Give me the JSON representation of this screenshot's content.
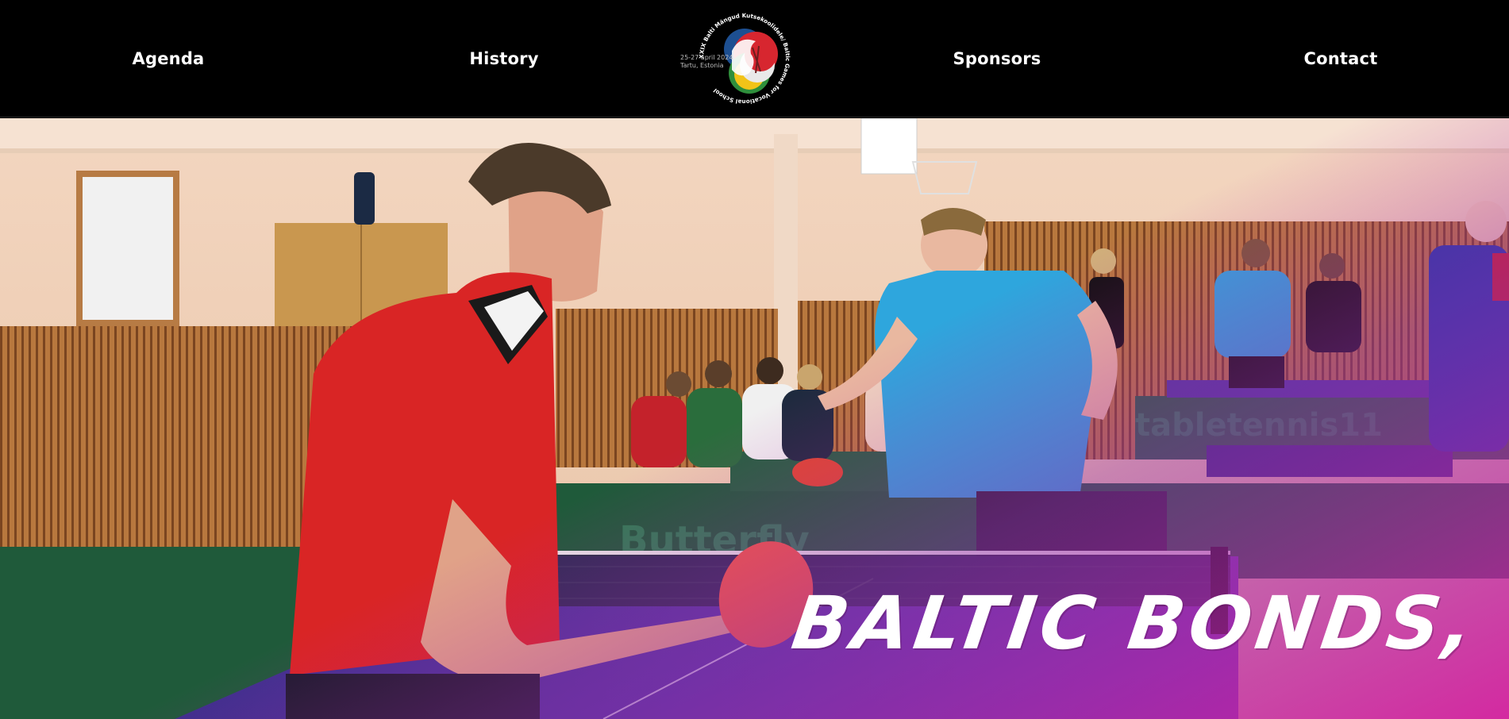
{
  "nav": {
    "agenda": "Agenda",
    "history": "History",
    "sponsors": "Sponsors",
    "contact": "Contact"
  },
  "logo": {
    "ring_text": "XXIX Balti Mängud Kutsekoolidele/ Baltic Games for Vocational School",
    "date_line_1": "25-27 april 2024",
    "date_line_2": "Tartu, Estonia"
  },
  "hero": {
    "headline": "BALTIC BONDS,",
    "headline_partial": ""
  },
  "colors": {
    "header_bg": "#000000",
    "nav_text": "#ffffff",
    "overlay_magenta": "#c21fa5",
    "overlay_purple": "#6a2a9a",
    "table_blue": "#4a3a9c",
    "barrier_green": "#1f5a3a"
  }
}
